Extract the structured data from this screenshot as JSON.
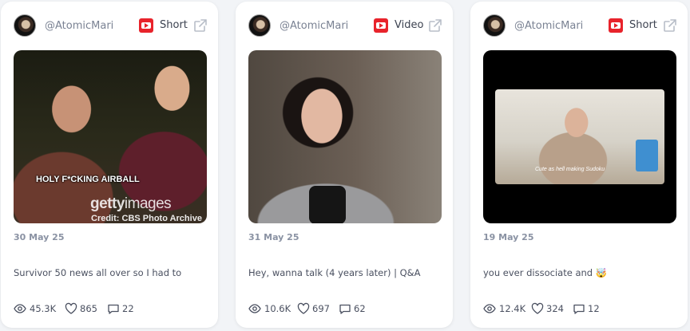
{
  "cards": [
    {
      "handle": "@AtomicMari",
      "type": "Short",
      "date": "30 May 25",
      "title": "Survivor 50 news all over so I had to",
      "thumb_text": "HOLY F*CKING AIRBALL",
      "watermark": {
        "brand_bold": "getty",
        "brand_light": "images",
        "credit": "Credit: CBS Photo Archive"
      },
      "views": "45.3K",
      "likes": "865",
      "comments": "22"
    },
    {
      "handle": "@AtomicMari",
      "type": "Video",
      "date": "31 May 25",
      "title": "Hey, wanna talk (4 years later) | Q&A",
      "views": "10.6K",
      "likes": "697",
      "comments": "62"
    },
    {
      "handle": "@AtomicMari",
      "type": "Short",
      "date": "19 May 25",
      "title": "you ever dissociate and 🤯",
      "thumb_caption": "Cute as hell making Sudoku",
      "views": "12.4K",
      "likes": "324",
      "comments": "12"
    }
  ],
  "icons": {
    "platform": "youtube-icon",
    "external": "external-link-icon",
    "views": "eye-icon",
    "likes": "heart-icon",
    "comments": "comment-icon"
  },
  "colors": {
    "background": "#f2f4f7",
    "card": "#ffffff",
    "youtube_red": "#e8232b",
    "muted_text": "#8a92a3",
    "body_text": "#4a5060"
  }
}
